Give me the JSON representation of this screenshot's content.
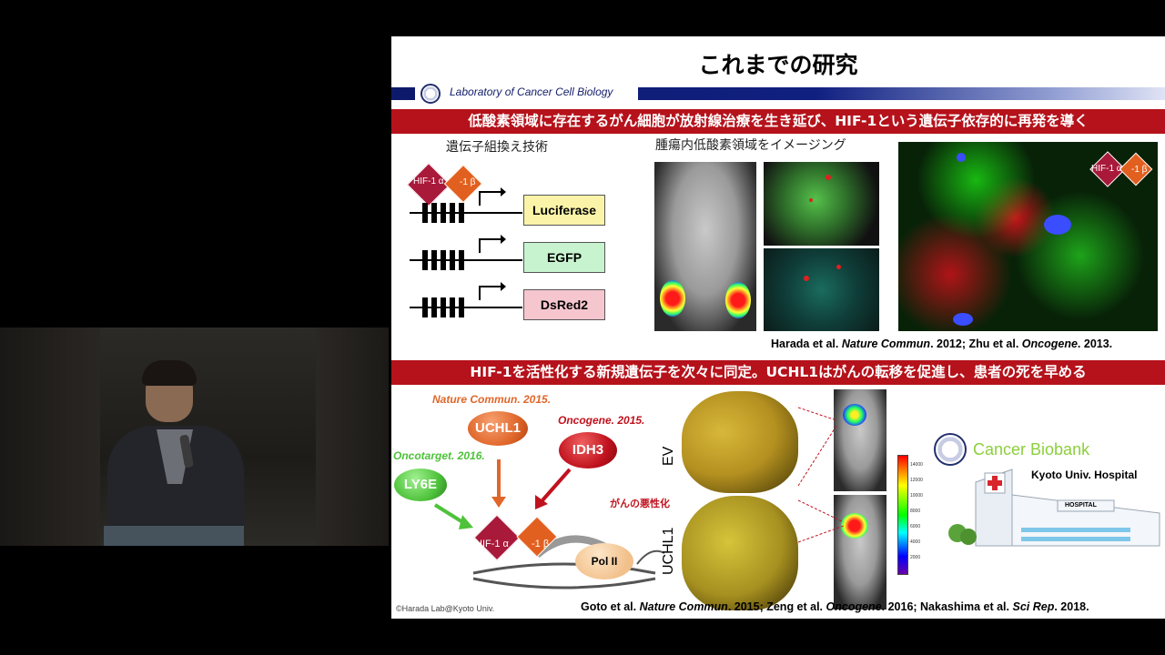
{
  "slide": {
    "title": "これまでの研究",
    "lab_name": "Laboratory of Cancer Cell Biology",
    "banner_top": "低酸素領域に存在するがん細胞が放射線治療を生き延び、HIF-1という遺伝子依存的に再発を導く",
    "banner_bottom": "HIF-1を活性化する新規遺伝子を次々に同定。UCHL1はがんの転移を促進し、患者の死を早める",
    "top_section": {
      "gene_tech_label": "遺伝子組換え技術",
      "imaging_label": "腫瘍内低酸素領域をイメージング",
      "hif_alpha": "HIF-1 α",
      "hif_beta": "-1 β",
      "reporters": [
        {
          "label": "Luciferase",
          "color": "#fbf4a8"
        },
        {
          "label": "EGFP",
          "color": "#c8f3cf"
        },
        {
          "label": "DsRed2",
          "color": "#f6c6cf"
        }
      ],
      "confocal_hif_alpha": "HIF-1 α",
      "confocal_hif_beta": "-1 β",
      "reference_parts": [
        "Harada et al. ",
        "Nature Commun",
        ". 2012; Zhu et al. ",
        "Oncogene",
        ". 2013."
      ]
    },
    "bottom_section": {
      "journals": {
        "nature": "Nature Commun. 2015.",
        "oncogene": "Oncogene. 2015.",
        "oncotarget": "Oncotarget. 2016."
      },
      "genes": {
        "uchl1": "UCHL1",
        "idh3": "IDH3",
        "ly6e": "LY6E"
      },
      "malignancy_label": "がんの悪性化",
      "hif_alpha": "HIF-1 α",
      "hif_beta": "-1 β",
      "pol2": "Pol II",
      "ev_label": "EV",
      "uchl1_label": "UCHL1",
      "colorbar_ticks": [
        "14000",
        "12000",
        "10000",
        "8000",
        "6000",
        "4000",
        "2000"
      ],
      "biobank_title": "Cancer Biobank",
      "hospital_name": "Kyoto Univ. Hospital",
      "hospital_sign": "HOSPITAL",
      "copyright": "©Harada Lab@Kyoto Univ.",
      "reference_parts": [
        "Goto et al. ",
        "Nature Commun",
        ". 2015; Zeng et al. ",
        "Oncogene",
        ". 2016; Nakashima et al. ",
        "Sci Rep",
        ". 2018."
      ]
    }
  },
  "colors": {
    "banner_red": "#b5121b",
    "hif_alpha": "#a8193a",
    "hif_beta": "#e2601f",
    "uchl1": "#e0662a",
    "idh3": "#c0121e",
    "ly6e": "#4ec23a",
    "nature_label": "#e0662a",
    "oncogene_label": "#c0121e",
    "oncotarget_label": "#4ec23a"
  }
}
